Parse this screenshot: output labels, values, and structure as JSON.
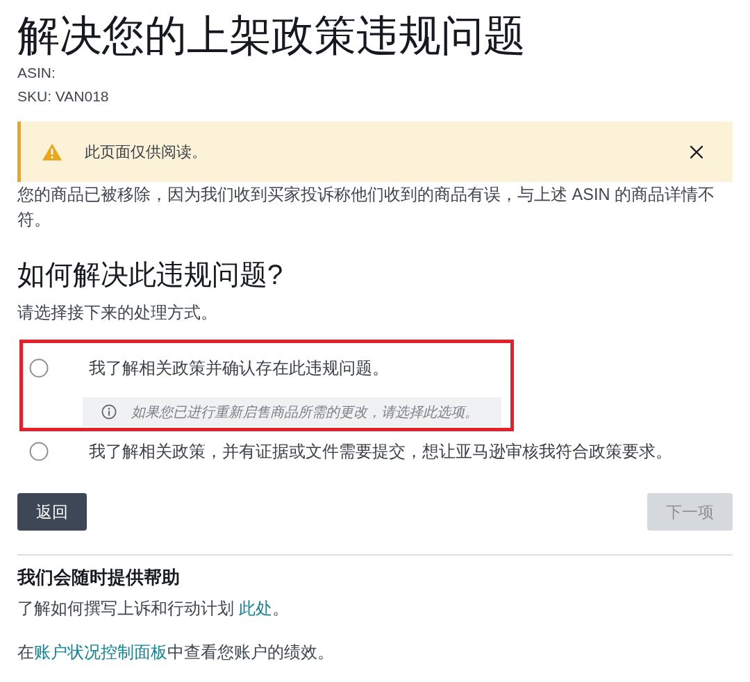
{
  "page": {
    "title": "解决您的上架政策违规问题",
    "asin": "ASIN:",
    "sku": "SKU: VAN018"
  },
  "alert": {
    "kind": "warning",
    "message": "此页面仅供阅读。",
    "dismissible": true
  },
  "description": "您的商品已被移除，因为我们收到买家投诉称他们收到的商品有误，与上述 ASIN 的商品详情不符。",
  "question": {
    "heading": "如何解决此违规问题?",
    "instruction": "请选择接下来的处理方式。"
  },
  "options": [
    {
      "label": "我了解相关政策并确认存在此违规问题。",
      "selected": false,
      "highlighted": true,
      "hint": "如果您已进行重新启售商品所需的更改，请选择此选项。"
    },
    {
      "label": "我了解相关政策，并有证据或文件需要提交，想让亚马逊审核我符合政策要求。",
      "selected": false,
      "highlighted": false
    }
  ],
  "buttons": [
    {
      "label": "返回",
      "disabled": false
    },
    {
      "label": "下一项",
      "disabled": true
    }
  ],
  "help": {
    "heading": "我们会随时提供帮助",
    "lines": [
      [
        {
          "kind": "text",
          "text": "了解如何撰写上诉和行动计划 "
        },
        {
          "kind": "link",
          "text": "此处"
        },
        {
          "kind": "text",
          "text": "。"
        }
      ],
      [
        {
          "kind": "text",
          "text": "在"
        },
        {
          "kind": "link",
          "text": "账户状况控制面板"
        },
        {
          "kind": "text",
          "text": "中查看您账户的绩效。"
        }
      ]
    ]
  }
}
